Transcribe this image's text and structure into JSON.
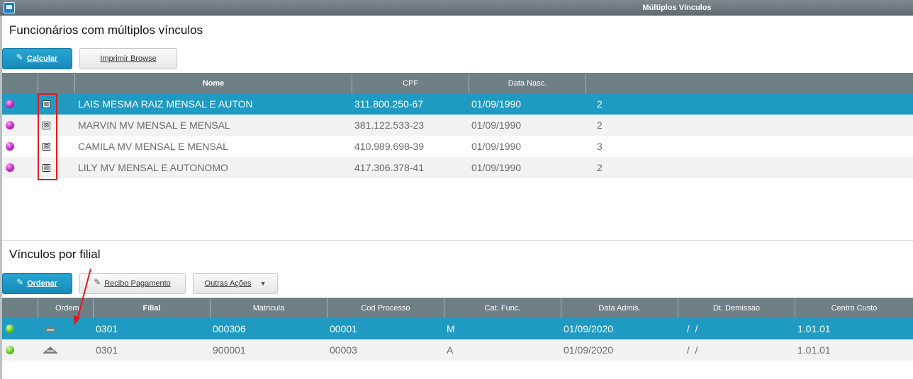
{
  "window": {
    "title": "Múltiplos Vínculos"
  },
  "section1": {
    "title": "Funcionários com múltiplos vínculos",
    "calcular_label": "Calcular",
    "imprimir_label": "Imprimir Browse",
    "columns": [
      "Nome",
      "CPF",
      "Data Nasc."
    ],
    "rows": [
      {
        "nome": "LAIS MESMA RAIZ MENSAL E AUTON",
        "cpf": "311.800.250-67",
        "data_nasc": "01/09/1990",
        "qtd": "2"
      },
      {
        "nome": "MARVIN MV MENSAL E MENSAL",
        "cpf": "381.122.533-23",
        "data_nasc": "01/09/1990",
        "qtd": "2"
      },
      {
        "nome": "CAMILA MV MENSAL E MENSAL",
        "cpf": "410.989.698-39",
        "data_nasc": "01/09/1990",
        "qtd": "3"
      },
      {
        "nome": "LILY MV MENSAL E AUTONOMO",
        "cpf": "417.306.378-41",
        "data_nasc": "01/09/1990",
        "qtd": "2"
      }
    ],
    "selected_row": 0,
    "status_color": "#c21dc2"
  },
  "section2": {
    "title": "Vínculos por filial",
    "ordenar_label": "Ordenar",
    "recibo_label": "Recibo Pagamento",
    "outras_label": "Outras Ações",
    "columns": [
      "Ordem",
      "Filial",
      "Matricula",
      "Cod Processo",
      "Cat. Func.",
      "Data Admis.",
      "Dt. Demissao",
      "Centro Custo"
    ],
    "rows": [
      {
        "filial": "0301",
        "matricula": "000306",
        "cod_processo": "00001",
        "cat_func": "M",
        "data_admis": "01/09/2020",
        "dt_demissao": " /  /",
        "centro_custo": "1.01.01"
      },
      {
        "filial": "0301",
        "matricula": "900001",
        "cod_processo": "00003",
        "cat_func": "A",
        "data_admis": "01/09/2020",
        "dt_demissao": " /  /",
        "centro_custo": "1.01.01"
      }
    ],
    "selected_row": 0,
    "status_color": "#5cc21d"
  },
  "colors": {
    "primary_button": "#1f9ac2",
    "selected_row": "#1f9ac2",
    "header": "#6f7f86",
    "annotation": "#e01a1a"
  },
  "icons": {
    "checkbox": "checkbox-checked-icon",
    "sort": "sort-triangle-icon",
    "edit": "pencil-icon",
    "dropdown": "chevron-down-icon"
  }
}
